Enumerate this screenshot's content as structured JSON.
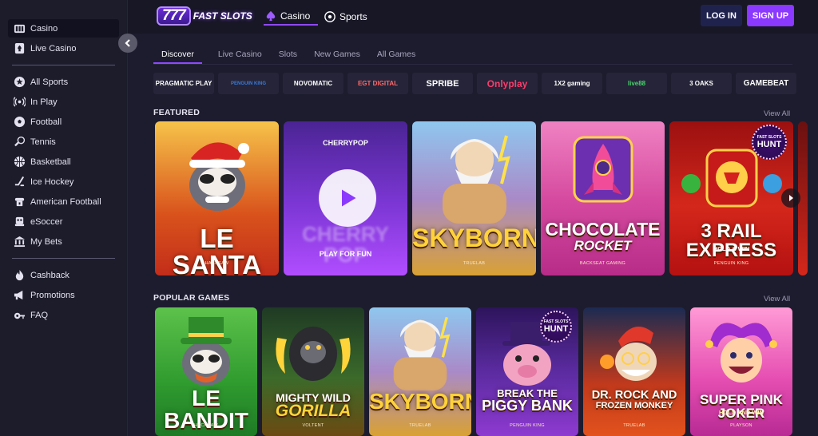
{
  "sidebar": {
    "items": [
      {
        "label": "Casino",
        "icon": "casino-icon"
      },
      {
        "label": "Live Casino",
        "icon": "spade-icon"
      },
      {
        "label": "All Sports",
        "icon": "star-icon"
      },
      {
        "label": "In Play",
        "icon": "broadcast-icon"
      },
      {
        "label": "Football",
        "icon": "football-icon"
      },
      {
        "label": "Tennis",
        "icon": "tennis-racket-icon"
      },
      {
        "label": "Basketball",
        "icon": "basketball-icon"
      },
      {
        "label": "Ice Hockey",
        "icon": "hockey-stick-icon"
      },
      {
        "label": "American Football",
        "icon": "american-football-icon"
      },
      {
        "label": "eSoccer",
        "icon": "gamepad-icon"
      },
      {
        "label": "My Bets",
        "icon": "bets-icon"
      },
      {
        "label": "Cashback",
        "icon": "flame-icon"
      },
      {
        "label": "Promotions",
        "icon": "megaphone-icon"
      },
      {
        "label": "FAQ",
        "icon": "faq-icon"
      }
    ]
  },
  "header": {
    "logo_number": "777",
    "logo_text": "FAST SLOTS",
    "tabs": [
      {
        "label": "Casino"
      },
      {
        "label": "Sports"
      }
    ],
    "login_label": "LOG IN",
    "signup_label": "SIGN UP"
  },
  "subnav": [
    "Discover",
    "Live Casino",
    "Slots",
    "New Games",
    "All Games"
  ],
  "providers": [
    "PRAGMATIC PLAY",
    "PENGUIN KING",
    "NOVOMATIC",
    "EGT DIGITAL",
    "SPRIBE",
    "Onlyplay",
    "1X2 gaming",
    "live88",
    "3 OAKS",
    "GAMEBEAT"
  ],
  "featured": {
    "title": "FEATURED",
    "view_all": "View All",
    "games": [
      {
        "name": "LE SANTA",
        "provider": "HACKSAW"
      },
      {
        "name": "CHERRY POP",
        "top": "CHERRYPOP",
        "hover": "PLAY FOR FUN"
      },
      {
        "name": "SKYBORN",
        "provider": "TRUELAB"
      },
      {
        "name": "CHOCOLATE",
        "name2": "ROCKET",
        "provider": "BACKSEAT GAMING"
      },
      {
        "name": "3 RAIL EXPRESS",
        "sub": "HOLD & WIN",
        "provider": "PENGUIN KING",
        "hunt_top": "FAST SLOTS",
        "hunt": "HUNT"
      }
    ]
  },
  "popular": {
    "title": "POPULAR GAMES",
    "view_all": "View All",
    "games": [
      {
        "name": "LE BANDIT",
        "provider": "HACKSAW"
      },
      {
        "name": "MIGHTY WILD",
        "name2": "GORILLA",
        "provider": "VOLTENT"
      },
      {
        "name": "SKYBORN",
        "provider": "TRUELAB"
      },
      {
        "name": "BREAK THE",
        "name2": "PIGGY BANK",
        "provider": "PENGUIN KING",
        "hunt_top": "FAST SLOTS",
        "hunt": "HUNT"
      },
      {
        "name": "DR. ROCK AND",
        "name2": "FROZEN MONKEY",
        "provider": "TRUELAB"
      },
      {
        "name": "SUPER PINK JOKER",
        "sub": "HOLD AND WIN",
        "provider": "PLAYSON"
      }
    ]
  },
  "colors": {
    "accent": "#8b38ff",
    "bg": "#1d1c2e",
    "login_bg": "#20224e"
  }
}
